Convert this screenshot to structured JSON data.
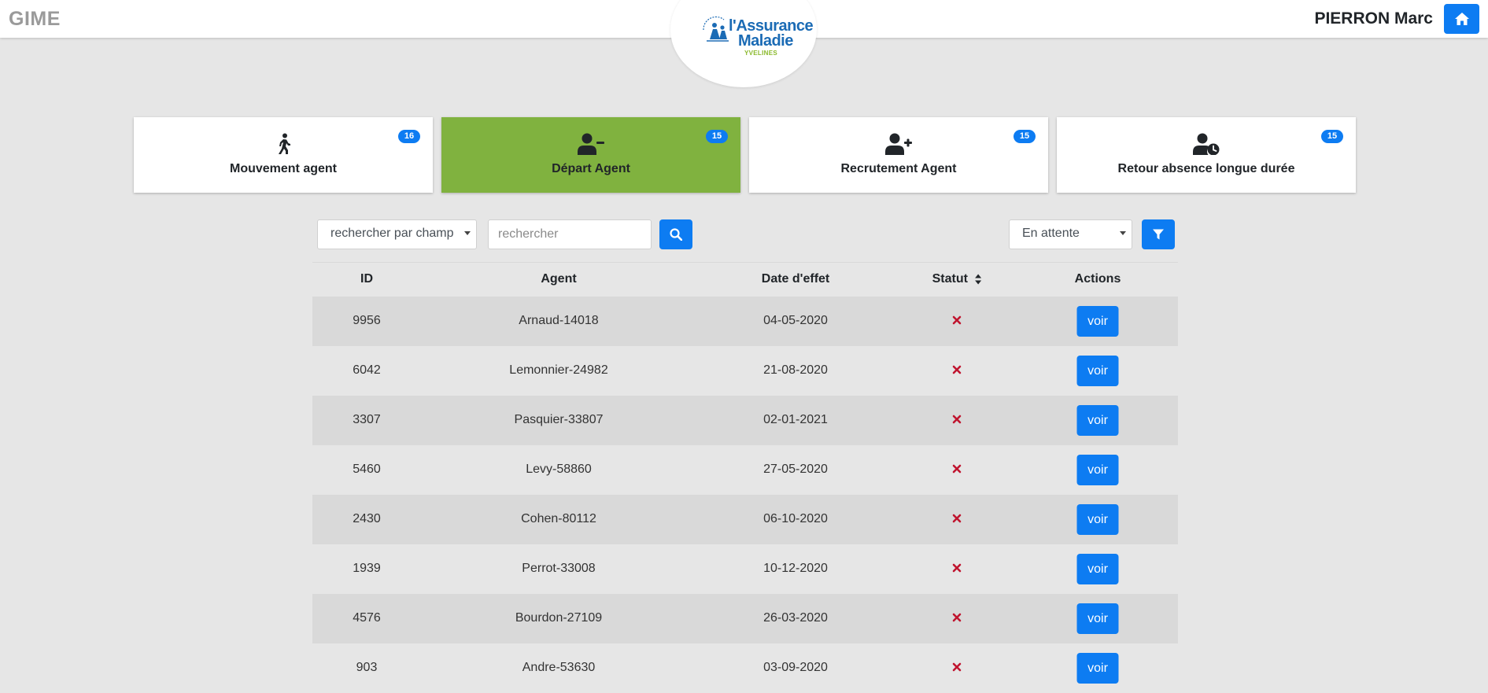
{
  "header": {
    "app_name": "GIME",
    "user_name": "PIERRON Marc",
    "home_icon": "home-icon",
    "logo": {
      "line1": "l'Assurance",
      "line2": "Maladie",
      "line3": "YVELINES"
    }
  },
  "cards": [
    {
      "label": "Mouvement agent",
      "count": "16",
      "icon": "walking-person-icon",
      "active": false
    },
    {
      "label": "Départ Agent",
      "count": "15",
      "icon": "user-minus-icon",
      "active": true
    },
    {
      "label": "Recrutement Agent",
      "count": "15",
      "icon": "user-plus-icon",
      "active": false
    },
    {
      "label": "Retour absence longue durée",
      "count": "15",
      "icon": "user-clock-icon",
      "active": false
    }
  ],
  "toolbar": {
    "field_select_value": "rechercher par champ",
    "search_placeholder": "rechercher",
    "status_select_value": "En attente",
    "search_icon": "search-icon",
    "filter_icon": "filter-icon"
  },
  "table": {
    "columns": {
      "id": "ID",
      "agent": "Agent",
      "date": "Date d'effet",
      "status": "Statut",
      "actions": "Actions"
    },
    "rows": [
      {
        "id": "9956",
        "agent": "Arnaud-14018",
        "date": "04-05-2020",
        "status": "x-icon",
        "action": "voir"
      },
      {
        "id": "6042",
        "agent": "Lemonnier-24982",
        "date": "21-08-2020",
        "status": "x-icon",
        "action": "voir"
      },
      {
        "id": "3307",
        "agent": "Pasquier-33807",
        "date": "02-01-2021",
        "status": "x-icon",
        "action": "voir"
      },
      {
        "id": "5460",
        "agent": "Levy-58860",
        "date": "27-05-2020",
        "status": "x-icon",
        "action": "voir"
      },
      {
        "id": "2430",
        "agent": "Cohen-80112",
        "date": "06-10-2020",
        "status": "x-icon",
        "action": "voir"
      },
      {
        "id": "1939",
        "agent": "Perrot-33008",
        "date": "10-12-2020",
        "status": "x-icon",
        "action": "voir"
      },
      {
        "id": "4576",
        "agent": "Bourdon-27109",
        "date": "26-03-2020",
        "status": "x-icon",
        "action": "voir"
      },
      {
        "id": "903",
        "agent": "Andre-53630",
        "date": "03-09-2020",
        "status": "x-icon",
        "action": "voir"
      }
    ]
  },
  "colors": {
    "primary": "#0d7cf2",
    "active_card": "#80b23f",
    "status_x": "#c0152f",
    "brand_text": "#9a9a9a"
  }
}
